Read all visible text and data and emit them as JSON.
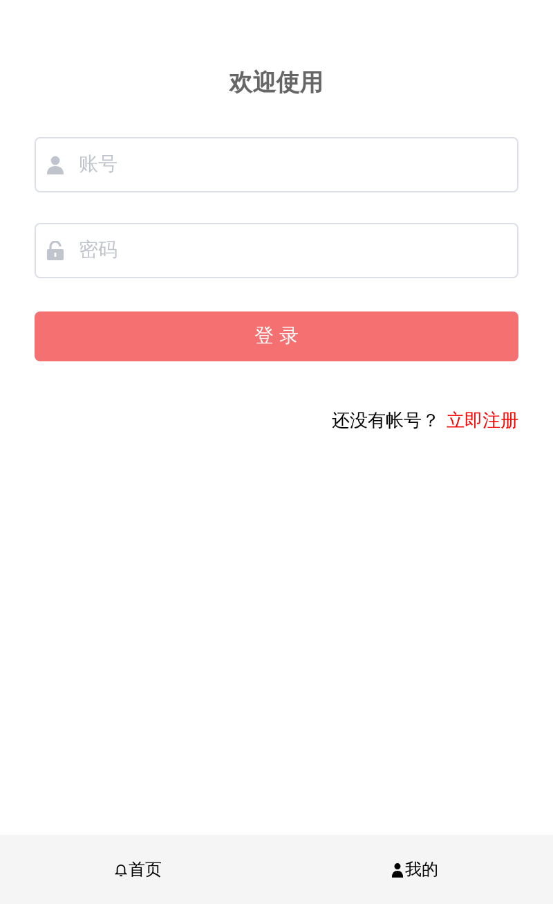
{
  "title": "欢迎使用",
  "fields": [
    {
      "kind": "user",
      "placeholder": "账号"
    },
    {
      "kind": "lock",
      "placeholder": "密码"
    }
  ],
  "login_button": "登 录",
  "register": {
    "prompt": "还没有帐号？",
    "link": "立即注册"
  },
  "tab_bar": [
    {
      "kind": "home",
      "label": "首页"
    },
    {
      "kind": "user",
      "label": "我的"
    }
  ]
}
